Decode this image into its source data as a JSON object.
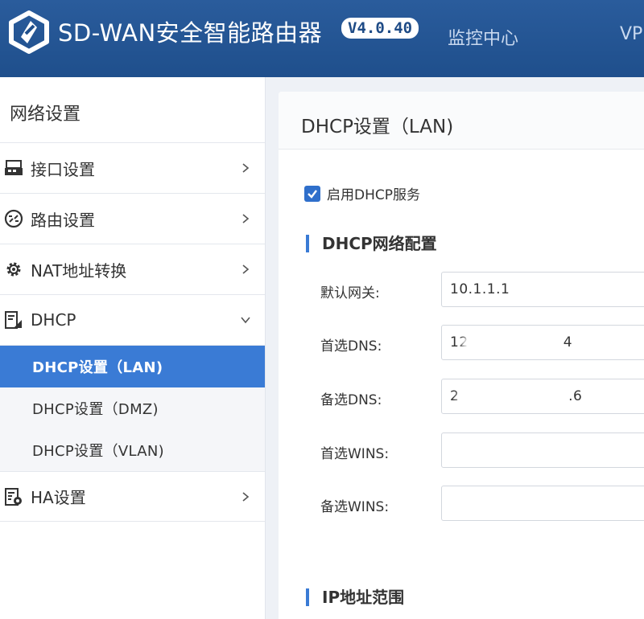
{
  "header": {
    "brand": "SD-WAN安全智能路由器",
    "version": "V4.0.40",
    "nav": [
      "监控中心",
      "VP"
    ]
  },
  "sidebar": {
    "title": "网络设置",
    "items": [
      {
        "label": "接口设置",
        "icon": "interface-icon"
      },
      {
        "label": "路由设置",
        "icon": "route-icon"
      },
      {
        "label": "NAT地址转换",
        "icon": "gear-icon"
      },
      {
        "label": "DHCP",
        "icon": "dhcp-icon",
        "expanded": true
      },
      {
        "label": "HA设置",
        "icon": "ha-icon"
      }
    ],
    "dhcp_sub": [
      {
        "label": "DHCP设置（LAN)",
        "active": true
      },
      {
        "label": "DHCP设置（DMZ)"
      },
      {
        "label": "DHCP设置（VLAN)"
      }
    ]
  },
  "main": {
    "title": "DHCP设置（LAN)",
    "enable_dhcp": {
      "label": "启用DHCP服务",
      "checked": true
    },
    "section_network": "DHCP网络配置",
    "fields": [
      {
        "label": "默认网关:",
        "value": "10.1.1.1"
      },
      {
        "label": "首选DNS:",
        "value": "12                    4"
      },
      {
        "label": "备选DNS:",
        "value": "2                       .6"
      },
      {
        "label": "首选WINS:",
        "value": ""
      },
      {
        "label": "备选WINS:",
        "value": ""
      }
    ],
    "section_ip": "IP地址范围"
  },
  "colors": {
    "header_bg": "#1f4f8c",
    "accent": "#3a7bd5"
  }
}
